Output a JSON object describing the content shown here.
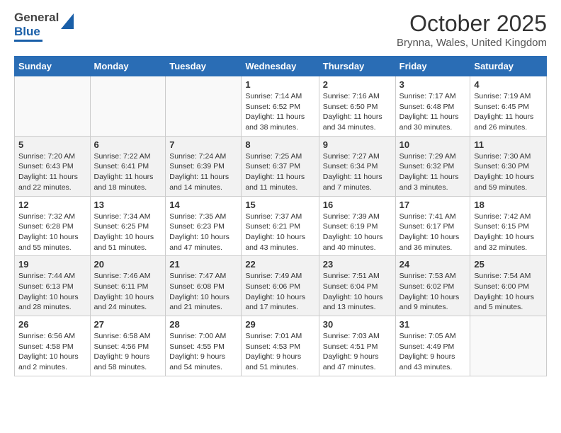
{
  "header": {
    "logo": {
      "line1": "General",
      "line2": "Blue"
    },
    "title": "October 2025",
    "subtitle": "Brynna, Wales, United Kingdom"
  },
  "days": [
    "Sunday",
    "Monday",
    "Tuesday",
    "Wednesday",
    "Thursday",
    "Friday",
    "Saturday"
  ],
  "weeks": [
    [
      {
        "date": "",
        "info": ""
      },
      {
        "date": "",
        "info": ""
      },
      {
        "date": "",
        "info": ""
      },
      {
        "date": "1",
        "info": "Sunrise: 7:14 AM\nSunset: 6:52 PM\nDaylight: 11 hours and 38 minutes."
      },
      {
        "date": "2",
        "info": "Sunrise: 7:16 AM\nSunset: 6:50 PM\nDaylight: 11 hours and 34 minutes."
      },
      {
        "date": "3",
        "info": "Sunrise: 7:17 AM\nSunset: 6:48 PM\nDaylight: 11 hours and 30 minutes."
      },
      {
        "date": "4",
        "info": "Sunrise: 7:19 AM\nSunset: 6:45 PM\nDaylight: 11 hours and 26 minutes."
      }
    ],
    [
      {
        "date": "5",
        "info": "Sunrise: 7:20 AM\nSunset: 6:43 PM\nDaylight: 11 hours and 22 minutes."
      },
      {
        "date": "6",
        "info": "Sunrise: 7:22 AM\nSunset: 6:41 PM\nDaylight: 11 hours and 18 minutes."
      },
      {
        "date": "7",
        "info": "Sunrise: 7:24 AM\nSunset: 6:39 PM\nDaylight: 11 hours and 14 minutes."
      },
      {
        "date": "8",
        "info": "Sunrise: 7:25 AM\nSunset: 6:37 PM\nDaylight: 11 hours and 11 minutes."
      },
      {
        "date": "9",
        "info": "Sunrise: 7:27 AM\nSunset: 6:34 PM\nDaylight: 11 hours and 7 minutes."
      },
      {
        "date": "10",
        "info": "Sunrise: 7:29 AM\nSunset: 6:32 PM\nDaylight: 11 hours and 3 minutes."
      },
      {
        "date": "11",
        "info": "Sunrise: 7:30 AM\nSunset: 6:30 PM\nDaylight: 10 hours and 59 minutes."
      }
    ],
    [
      {
        "date": "12",
        "info": "Sunrise: 7:32 AM\nSunset: 6:28 PM\nDaylight: 10 hours and 55 minutes."
      },
      {
        "date": "13",
        "info": "Sunrise: 7:34 AM\nSunset: 6:25 PM\nDaylight: 10 hours and 51 minutes."
      },
      {
        "date": "14",
        "info": "Sunrise: 7:35 AM\nSunset: 6:23 PM\nDaylight: 10 hours and 47 minutes."
      },
      {
        "date": "15",
        "info": "Sunrise: 7:37 AM\nSunset: 6:21 PM\nDaylight: 10 hours and 43 minutes."
      },
      {
        "date": "16",
        "info": "Sunrise: 7:39 AM\nSunset: 6:19 PM\nDaylight: 10 hours and 40 minutes."
      },
      {
        "date": "17",
        "info": "Sunrise: 7:41 AM\nSunset: 6:17 PM\nDaylight: 10 hours and 36 minutes."
      },
      {
        "date": "18",
        "info": "Sunrise: 7:42 AM\nSunset: 6:15 PM\nDaylight: 10 hours and 32 minutes."
      }
    ],
    [
      {
        "date": "19",
        "info": "Sunrise: 7:44 AM\nSunset: 6:13 PM\nDaylight: 10 hours and 28 minutes."
      },
      {
        "date": "20",
        "info": "Sunrise: 7:46 AM\nSunset: 6:11 PM\nDaylight: 10 hours and 24 minutes."
      },
      {
        "date": "21",
        "info": "Sunrise: 7:47 AM\nSunset: 6:08 PM\nDaylight: 10 hours and 21 minutes."
      },
      {
        "date": "22",
        "info": "Sunrise: 7:49 AM\nSunset: 6:06 PM\nDaylight: 10 hours and 17 minutes."
      },
      {
        "date": "23",
        "info": "Sunrise: 7:51 AM\nSunset: 6:04 PM\nDaylight: 10 hours and 13 minutes."
      },
      {
        "date": "24",
        "info": "Sunrise: 7:53 AM\nSunset: 6:02 PM\nDaylight: 10 hours and 9 minutes."
      },
      {
        "date": "25",
        "info": "Sunrise: 7:54 AM\nSunset: 6:00 PM\nDaylight: 10 hours and 5 minutes."
      }
    ],
    [
      {
        "date": "26",
        "info": "Sunrise: 6:56 AM\nSunset: 4:58 PM\nDaylight: 10 hours and 2 minutes."
      },
      {
        "date": "27",
        "info": "Sunrise: 6:58 AM\nSunset: 4:56 PM\nDaylight: 9 hours and 58 minutes."
      },
      {
        "date": "28",
        "info": "Sunrise: 7:00 AM\nSunset: 4:55 PM\nDaylight: 9 hours and 54 minutes."
      },
      {
        "date": "29",
        "info": "Sunrise: 7:01 AM\nSunset: 4:53 PM\nDaylight: 9 hours and 51 minutes."
      },
      {
        "date": "30",
        "info": "Sunrise: 7:03 AM\nSunset: 4:51 PM\nDaylight: 9 hours and 47 minutes."
      },
      {
        "date": "31",
        "info": "Sunrise: 7:05 AM\nSunset: 4:49 PM\nDaylight: 9 hours and 43 minutes."
      },
      {
        "date": "",
        "info": ""
      }
    ]
  ]
}
